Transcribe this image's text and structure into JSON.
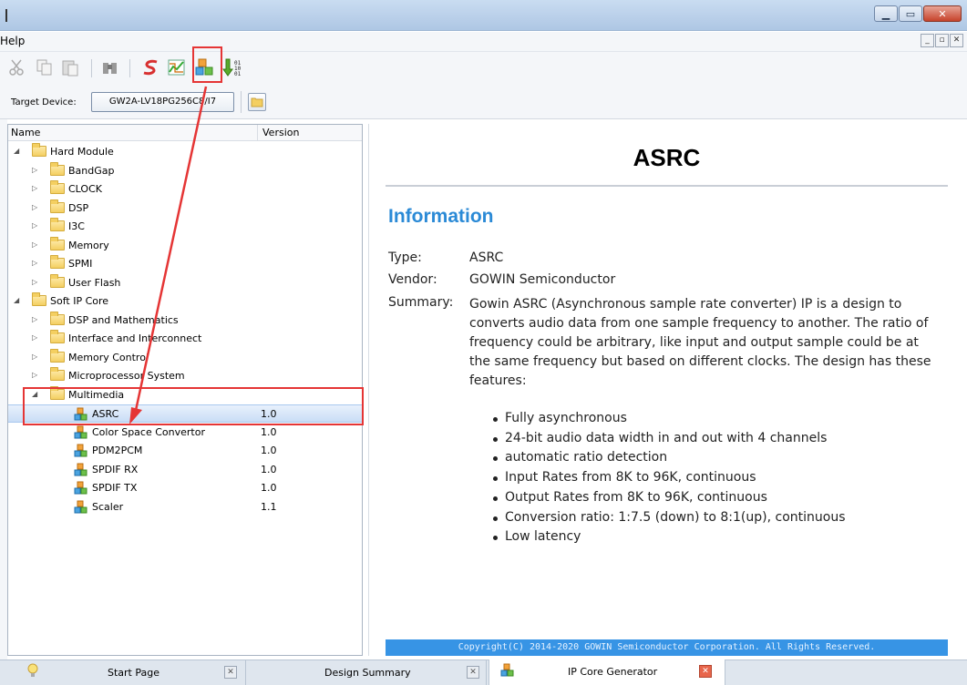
{
  "menu": {
    "help_label": "Help"
  },
  "device": {
    "label": "Target Device:",
    "value": "GW2A-LV18PG256C8/I7"
  },
  "tree": {
    "col_name": "Name",
    "col_version": "Version",
    "rows": [
      {
        "label": "Hard Module",
        "version": "",
        "type": "folder",
        "level": 0,
        "expanded": true
      },
      {
        "label": "BandGap",
        "version": "",
        "type": "folder",
        "level": 1,
        "expanded": false
      },
      {
        "label": "CLOCK",
        "version": "",
        "type": "folder",
        "level": 1,
        "expanded": false
      },
      {
        "label": "DSP",
        "version": "",
        "type": "folder",
        "level": 1,
        "expanded": false
      },
      {
        "label": "I3C",
        "version": "",
        "type": "folder",
        "level": 1,
        "expanded": false
      },
      {
        "label": "Memory",
        "version": "",
        "type": "folder",
        "level": 1,
        "expanded": false
      },
      {
        "label": "SPMI",
        "version": "",
        "type": "folder",
        "level": 1,
        "expanded": false
      },
      {
        "label": "User Flash",
        "version": "",
        "type": "folder",
        "level": 1,
        "expanded": false
      },
      {
        "label": "Soft IP Core",
        "version": "",
        "type": "folder",
        "level": 0,
        "expanded": true
      },
      {
        "label": "DSP and Mathematics",
        "version": "",
        "type": "folder",
        "level": 1,
        "expanded": false
      },
      {
        "label": "Interface and Interconnect",
        "version": "",
        "type": "folder",
        "level": 1,
        "expanded": false
      },
      {
        "label": "Memory Control",
        "version": "",
        "type": "folder",
        "level": 1,
        "expanded": false
      },
      {
        "label": "Microprocessor System",
        "version": "",
        "type": "folder",
        "level": 1,
        "expanded": false
      },
      {
        "label": "Multimedia",
        "version": "",
        "type": "folder",
        "level": 1,
        "expanded": true
      },
      {
        "label": "ASRC",
        "version": "1.0",
        "type": "ip",
        "level": 2,
        "selected": true
      },
      {
        "label": "Color Space Convertor",
        "version": "1.0",
        "type": "ip",
        "level": 2
      },
      {
        "label": "PDM2PCM",
        "version": "1.0",
        "type": "ip",
        "level": 2
      },
      {
        "label": "SPDIF RX",
        "version": "1.0",
        "type": "ip",
        "level": 2
      },
      {
        "label": "SPDIF TX",
        "version": "1.0",
        "type": "ip",
        "level": 2
      },
      {
        "label": "Scaler",
        "version": "1.1",
        "type": "ip",
        "level": 2
      }
    ]
  },
  "detail": {
    "title": "ASRC",
    "info_heading": "Information",
    "type_key": "Type:",
    "type_value": "ASRC",
    "vendor_key": "Vendor:",
    "vendor_value": "GOWIN Semiconductor",
    "summary_key": "Summary:",
    "summary_text": "Gowin ASRC (Asynchronous sample rate converter) IP is a design to converts audio data from one sample frequency to another. The ratio of frequency could be arbitrary, like input and output sample could be at the same frequency but based on different clocks. The design has these features:",
    "features": [
      "Fully asynchronous",
      "24-bit audio data width in and out with 4 channels",
      "automatic ratio detection",
      "Input Rates from 8K to 96K, continuous",
      "Output Rates from 8K to 96K, continuous",
      "Conversion ratio: 1:7.5 (down) to 8:1(up), continuous",
      "Low latency"
    ],
    "copyright": "Copyright(C) 2014-2020 GOWIN Semiconductor Corporation. All Rights Reserved."
  },
  "tabs": [
    {
      "label": "Start Page",
      "active": false
    },
    {
      "label": "Design Summary",
      "active": false
    },
    {
      "label": "IP Core Generator",
      "active": true
    }
  ],
  "colors": {
    "accent": "#2b8ad6",
    "footer": "#3794e5",
    "highlight": "#e53535",
    "selection": "#c9ddf6"
  }
}
